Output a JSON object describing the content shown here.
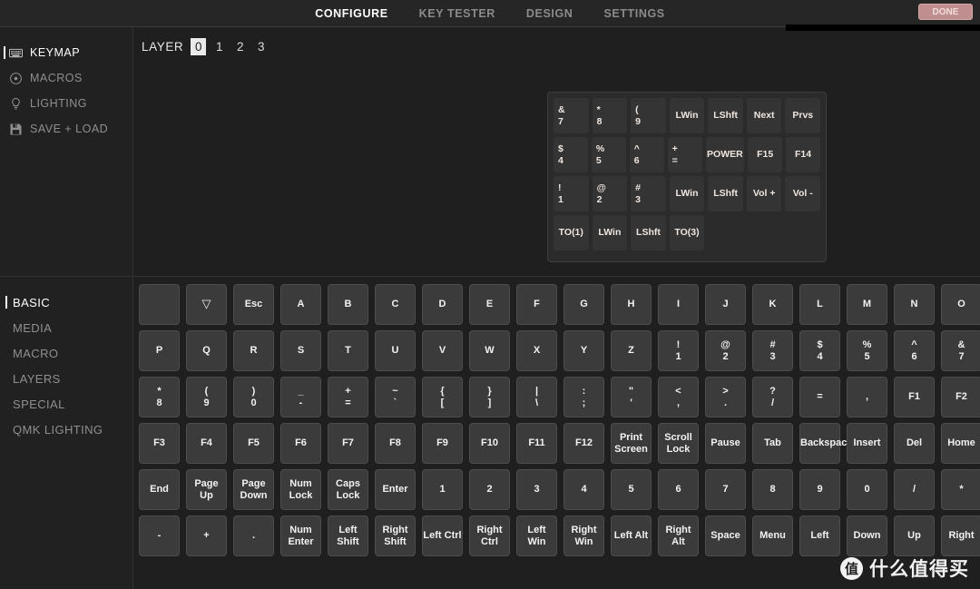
{
  "topbar": {
    "tabs": [
      {
        "label": "CONFIGURE",
        "active": true
      },
      {
        "label": "KEY TESTER",
        "active": false
      },
      {
        "label": "DESIGN",
        "active": false
      },
      {
        "label": "SETTINGS",
        "active": false
      }
    ],
    "redacted_button_label": "DONE"
  },
  "sidebar": {
    "nav": [
      {
        "label": "KEYMAP",
        "icon": "keyboard-icon",
        "active": true
      },
      {
        "label": "MACROS",
        "icon": "record-dot-icon",
        "active": false
      },
      {
        "label": "LIGHTING",
        "icon": "lightbulb-icon",
        "active": false
      },
      {
        "label": "SAVE + LOAD",
        "icon": "floppy-disk-icon",
        "active": false
      }
    ],
    "categories": [
      {
        "label": "BASIC",
        "active": true
      },
      {
        "label": "MEDIA",
        "active": false
      },
      {
        "label": "MACRO",
        "active": false
      },
      {
        "label": "LAYERS",
        "active": false
      },
      {
        "label": "SPECIAL",
        "active": false
      },
      {
        "label": "QMK LIGHTING",
        "active": false
      }
    ]
  },
  "keymap": {
    "layer_label": "LAYER",
    "layers": [
      "0",
      "1",
      "2",
      "3"
    ],
    "active_layer": "0",
    "board_rows": [
      [
        {
          "top": "&",
          "bottom": "7"
        },
        {
          "top": "*",
          "bottom": "8"
        },
        {
          "top": "(",
          "bottom": "9"
        },
        {
          "single": "LWin"
        },
        {
          "single": "LShft"
        },
        {
          "single": "Next"
        },
        {
          "single": "Prvs"
        }
      ],
      [
        {
          "top": "$",
          "bottom": "4"
        },
        {
          "top": "%",
          "bottom": "5"
        },
        {
          "top": "^",
          "bottom": "6"
        },
        {
          "top": "+",
          "bottom": "="
        },
        {
          "single": "POWER",
          "wide": true
        },
        {
          "single": "F15"
        },
        {
          "single": "F14"
        }
      ],
      [
        {
          "top": "!",
          "bottom": "1"
        },
        {
          "top": "@",
          "bottom": "2"
        },
        {
          "top": "#",
          "bottom": "3"
        },
        {
          "single": "LWin"
        },
        {
          "single": "LShft"
        },
        {
          "single": "Vol +"
        },
        {
          "single": "Vol -"
        }
      ],
      [
        {
          "single": "TO(1)"
        },
        {
          "single": "LWin"
        },
        {
          "single": "LShft"
        },
        {
          "single": "TO(3)"
        },
        {
          "blank": true
        },
        {
          "blank": true
        },
        {
          "blank": true
        }
      ]
    ]
  },
  "picker": {
    "rows": [
      [
        {
          "label": ""
        },
        {
          "label": "▽",
          "glyph": true
        },
        {
          "label": "Esc"
        },
        {
          "label": "A"
        },
        {
          "label": "B"
        },
        {
          "label": "C"
        },
        {
          "label": "D"
        },
        {
          "label": "E"
        },
        {
          "label": "F"
        },
        {
          "label": "G"
        },
        {
          "label": "H"
        },
        {
          "label": "I"
        },
        {
          "label": "J"
        },
        {
          "label": "K"
        },
        {
          "label": "L"
        },
        {
          "label": "M"
        },
        {
          "label": "N"
        },
        {
          "label": "O"
        }
      ],
      [
        {
          "label": "P"
        },
        {
          "label": "Q"
        },
        {
          "label": "R"
        },
        {
          "label": "S"
        },
        {
          "label": "T"
        },
        {
          "label": "U"
        },
        {
          "label": "V"
        },
        {
          "label": "W"
        },
        {
          "label": "X"
        },
        {
          "label": "Y"
        },
        {
          "label": "Z"
        },
        {
          "top": "!",
          "bottom": "1"
        },
        {
          "top": "@",
          "bottom": "2"
        },
        {
          "top": "#",
          "bottom": "3"
        },
        {
          "top": "$",
          "bottom": "4"
        },
        {
          "top": "%",
          "bottom": "5"
        },
        {
          "top": "^",
          "bottom": "6"
        },
        {
          "top": "&",
          "bottom": "7"
        }
      ],
      [
        {
          "top": "*",
          "bottom": "8"
        },
        {
          "top": "(",
          "bottom": "9"
        },
        {
          "top": ")",
          "bottom": "0"
        },
        {
          "top": "_",
          "bottom": "-"
        },
        {
          "top": "+",
          "bottom": "="
        },
        {
          "top": "~",
          "bottom": "`"
        },
        {
          "top": "{",
          "bottom": "["
        },
        {
          "top": "}",
          "bottom": "]"
        },
        {
          "top": "|",
          "bottom": "\\"
        },
        {
          "top": ":",
          "bottom": ";"
        },
        {
          "top": "\"",
          "bottom": "'"
        },
        {
          "top": "<",
          "bottom": ","
        },
        {
          "top": ">",
          "bottom": "."
        },
        {
          "top": "?",
          "bottom": "/"
        },
        {
          "label": "="
        },
        {
          "label": ","
        },
        {
          "label": "F1"
        },
        {
          "label": "F2"
        }
      ],
      [
        {
          "label": "F3"
        },
        {
          "label": "F4"
        },
        {
          "label": "F5"
        },
        {
          "label": "F6"
        },
        {
          "label": "F7"
        },
        {
          "label": "F8"
        },
        {
          "label": "F9"
        },
        {
          "label": "F10"
        },
        {
          "label": "F11"
        },
        {
          "label": "F12"
        },
        {
          "top": "Print",
          "bottom": "Screen"
        },
        {
          "top": "Scroll",
          "bottom": "Lock"
        },
        {
          "label": "Pause"
        },
        {
          "label": "Tab"
        },
        {
          "label": "Backspace",
          "overflow": true
        },
        {
          "label": "Insert"
        },
        {
          "label": "Del"
        },
        {
          "label": "Home"
        }
      ],
      [
        {
          "label": "End"
        },
        {
          "label": "Page Up"
        },
        {
          "top": "Page",
          "bottom": "Down"
        },
        {
          "top": "Num",
          "bottom": "Lock"
        },
        {
          "top": "Caps",
          "bottom": "Lock"
        },
        {
          "label": "Enter"
        },
        {
          "label": "1"
        },
        {
          "label": "2"
        },
        {
          "label": "3"
        },
        {
          "label": "4"
        },
        {
          "label": "5"
        },
        {
          "label": "6"
        },
        {
          "label": "7"
        },
        {
          "label": "8"
        },
        {
          "label": "9"
        },
        {
          "label": "0"
        },
        {
          "label": "/"
        },
        {
          "label": "*"
        }
      ],
      [
        {
          "label": "-"
        },
        {
          "label": "+"
        },
        {
          "label": "."
        },
        {
          "top": "Num",
          "bottom": "Enter"
        },
        {
          "top": "Left",
          "bottom": "Shift"
        },
        {
          "top": "Right",
          "bottom": "Shift"
        },
        {
          "label": "Left Ctrl"
        },
        {
          "top": "Right",
          "bottom": "Ctrl"
        },
        {
          "label": "Left Win"
        },
        {
          "top": "Right",
          "bottom": "Win"
        },
        {
          "label": "Left Alt"
        },
        {
          "label": "Right Alt"
        },
        {
          "label": "Space"
        },
        {
          "label": "Menu"
        },
        {
          "label": "Left"
        },
        {
          "label": "Down"
        },
        {
          "label": "Up"
        },
        {
          "label": "Right"
        }
      ]
    ]
  },
  "watermark": {
    "badge": "值",
    "text": "什么值得买"
  }
}
